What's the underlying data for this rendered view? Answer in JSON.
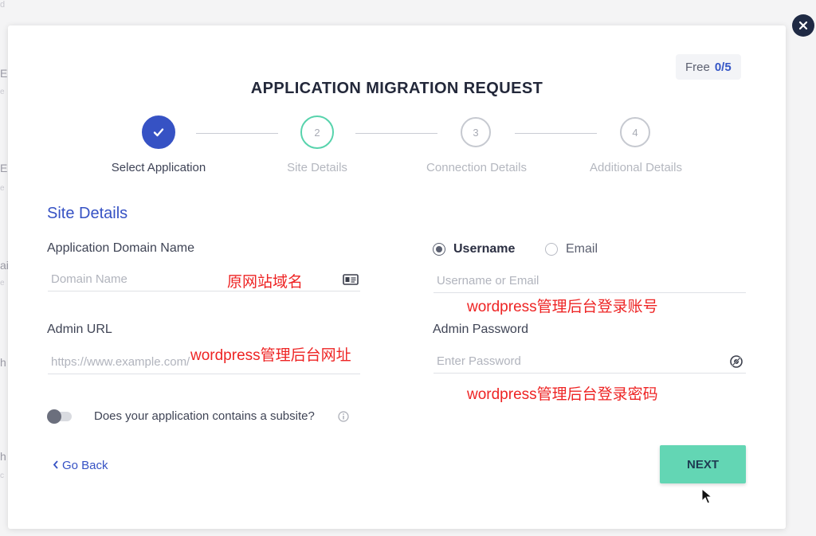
{
  "background": {
    "fragments": [
      "d",
      "E",
      "e",
      "E",
      "e",
      "ai",
      "e",
      "h",
      "h",
      "c"
    ]
  },
  "modal": {
    "title": "APPLICATION MIGRATION REQUEST",
    "plan_badge": {
      "label": "Free",
      "count": "0/5"
    },
    "close_icon": "close-icon"
  },
  "stepper": {
    "steps": [
      {
        "number": "1",
        "label": "Select Application",
        "state": "completed"
      },
      {
        "number": "2",
        "label": "Site Details",
        "state": "active"
      },
      {
        "number": "3",
        "label": "Connection Details",
        "state": "pending"
      },
      {
        "number": "4",
        "label": "Additional Details",
        "state": "pending"
      }
    ]
  },
  "form": {
    "section_title": "Site Details",
    "domain": {
      "label": "Application Domain Name",
      "placeholder": "Domain Name",
      "value": "",
      "icon": "id-card-icon"
    },
    "admin_url": {
      "label": "Admin URL",
      "placeholder": "https://www.example.com/",
      "value": ""
    },
    "login_type": {
      "options": [
        "Username",
        "Email"
      ],
      "selected": "Username"
    },
    "username": {
      "placeholder": "Username or Email",
      "value": ""
    },
    "password": {
      "label": "Admin Password",
      "placeholder": "Enter Password",
      "value": "",
      "icon": "eye-icon"
    },
    "subsite": {
      "label": "Does your application contains a subsite?",
      "enabled": false,
      "icon": "info-icon"
    }
  },
  "actions": {
    "back": "Go Back",
    "back_icon": "chevron-left-icon",
    "next": "NEXT"
  },
  "annotations": {
    "domain": "原网站域名",
    "admin_url": "wordpress管理后台网址",
    "username": "wordpress管理后台登录账号",
    "password": "wordpress管理后台登录密码"
  },
  "colors": {
    "accent": "#3652c4",
    "step_active": "#57d3ac",
    "next_button": "#63d6b4",
    "annotation": "#ee2424"
  }
}
